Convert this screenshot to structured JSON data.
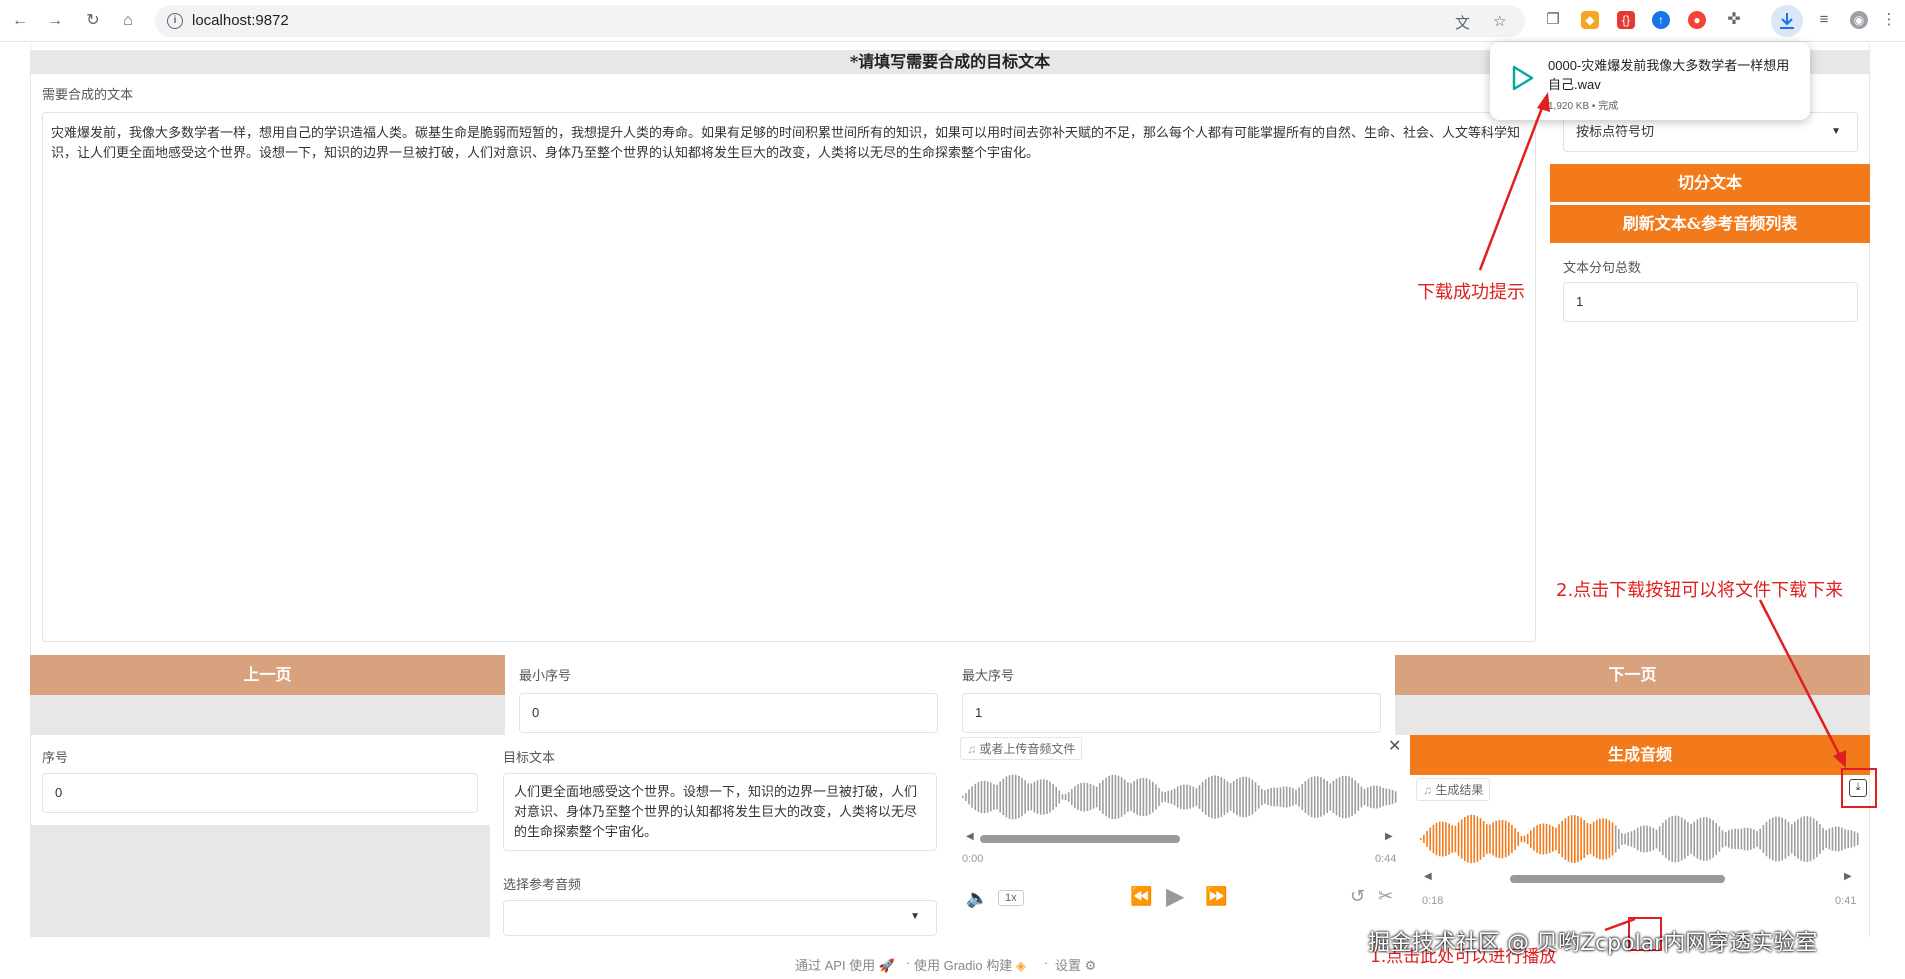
{
  "browser": {
    "url": "localhost:9872"
  },
  "download_popup": {
    "filename": "0000-灾难爆发前我像大多数学者一样想用自己.wav",
    "meta": "1,920 KB • 完成"
  },
  "app": {
    "section_title": "*请填写需要合成的目标文本",
    "text_label": "需要合成的文本",
    "text_value": "灾难爆发前，我像大多数学者一样，想用自己的学识造福人类。碳基生命是脆弱而短暂的，我想提升人类的寿命。如果有足够的时间积累世间所有的知识，如果可以用时间去弥补天赋的不足，那么每个人都有可能掌握所有的自然、生命、社会、人文等科学知识，让人们更全面地感受这个世界。设想一下，知识的边界一旦被打破，人们对意识、身体乃至整个世界的认知都将发生巨大的改变，人类将以无尽的生命探索整个宇宙化。",
    "split_method_value": "按标点符号切",
    "split_button": "切分文本",
    "refresh_button": "刷新文本&参考音频列表",
    "total_sentences_label": "文本分句总数",
    "total_sentences_value": "1",
    "prev_button": "上一页",
    "next_button": "下一页",
    "min_index_label": "最小序号",
    "min_index_value": "0",
    "max_index_label": "最大序号",
    "max_index_value": "1",
    "index_label": "序号",
    "index_value": "0",
    "target_text_label": "目标文本",
    "target_text_value": "人们更全面地感受这个世界。设想一下，知识的边界一旦被打破，人们对意识、身体乃至整个世界的认知都将发生巨大的改变，人类将以无尽的生命探索整个宇宙化。",
    "ref_audio_label": "选择参考音频",
    "upload_audio_label": "或者上传音频文件",
    "upload_time_start": "0:00",
    "upload_time_end": "0:44",
    "speed_label": "1x",
    "generate_button": "生成音频",
    "result_label": "生成结果",
    "result_time_start": "0:18",
    "result_time_end": "0:41"
  },
  "annotations": {
    "download_success": "下载成功提示",
    "click_download": "2.点击下载按钮可以将文件下载下来",
    "click_play": "1.点击此处可以进行播放"
  },
  "footer": {
    "api": "通过 API 使用",
    "gradio": "使用 Gradio 构建",
    "settings": "设置"
  },
  "watermark": "掘金技术社区 @ 贝哟Zcpolar内网穿透实验室",
  "colors": {
    "orange": "#f27a1a",
    "peach": "#d9a27e",
    "annotation_red": "#e02020"
  }
}
